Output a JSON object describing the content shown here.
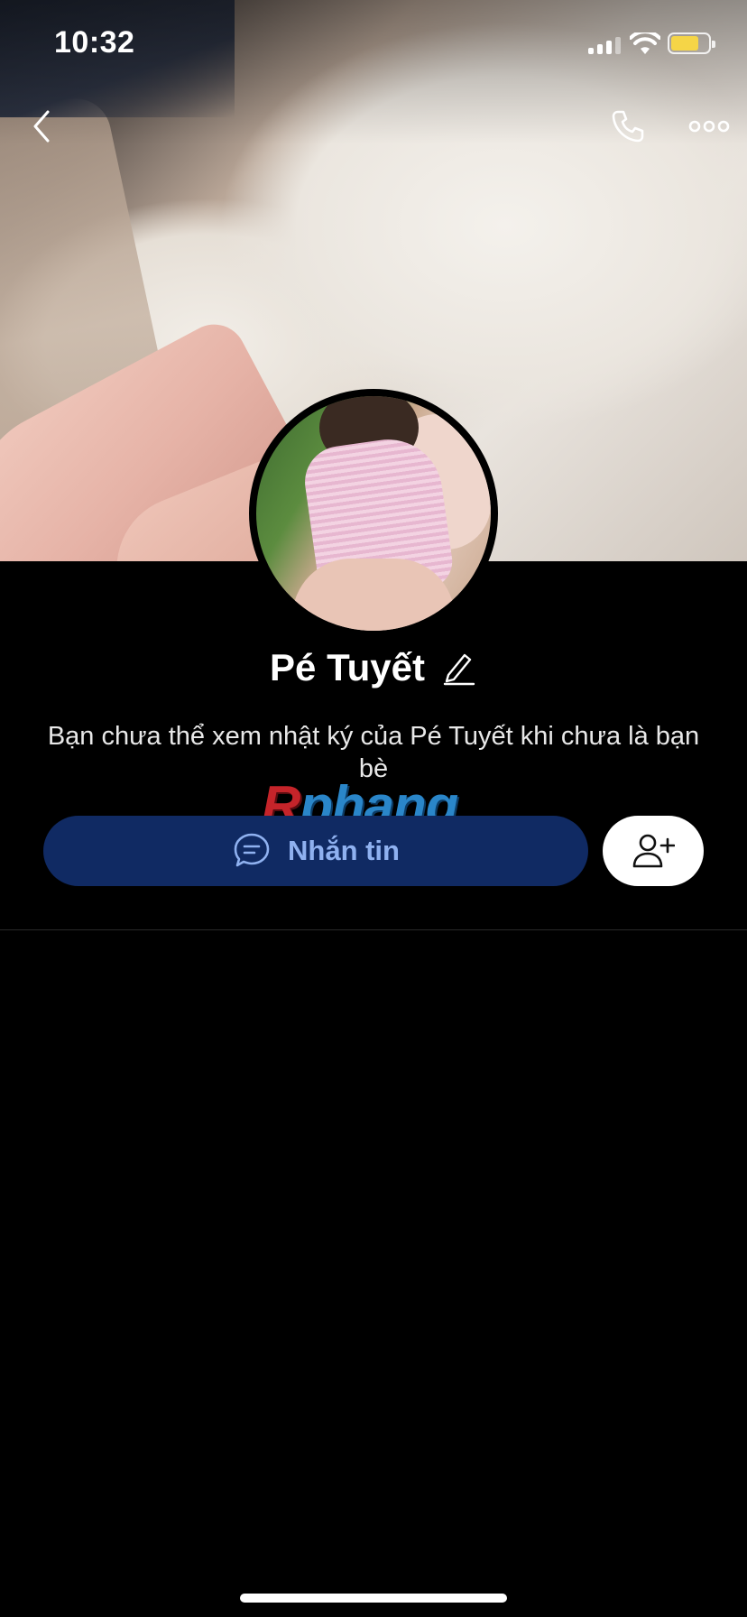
{
  "status_bar": {
    "time": "10:32",
    "battery_level": 0.75,
    "battery_color": "#f5d547"
  },
  "nav": {
    "back_icon": "chevron-left-icon",
    "call_icon": "phone-icon",
    "more_icon": "more-horizontal-icon"
  },
  "profile": {
    "name": "Pé Tuyết",
    "edit_icon": "pencil-icon",
    "description": "Bạn chưa thể xem nhật ký của Pé Tuyết khi chưa là bạn bè"
  },
  "actions": {
    "message_label": "Nhắn tin",
    "message_icon": "chat-bubble-icon",
    "add_friend_icon": "add-friend-icon"
  },
  "watermark": {
    "text_a": "R",
    "text_b": "phang"
  },
  "colors": {
    "message_button_bg": "#102a63",
    "message_button_text": "#8fb1f0"
  }
}
